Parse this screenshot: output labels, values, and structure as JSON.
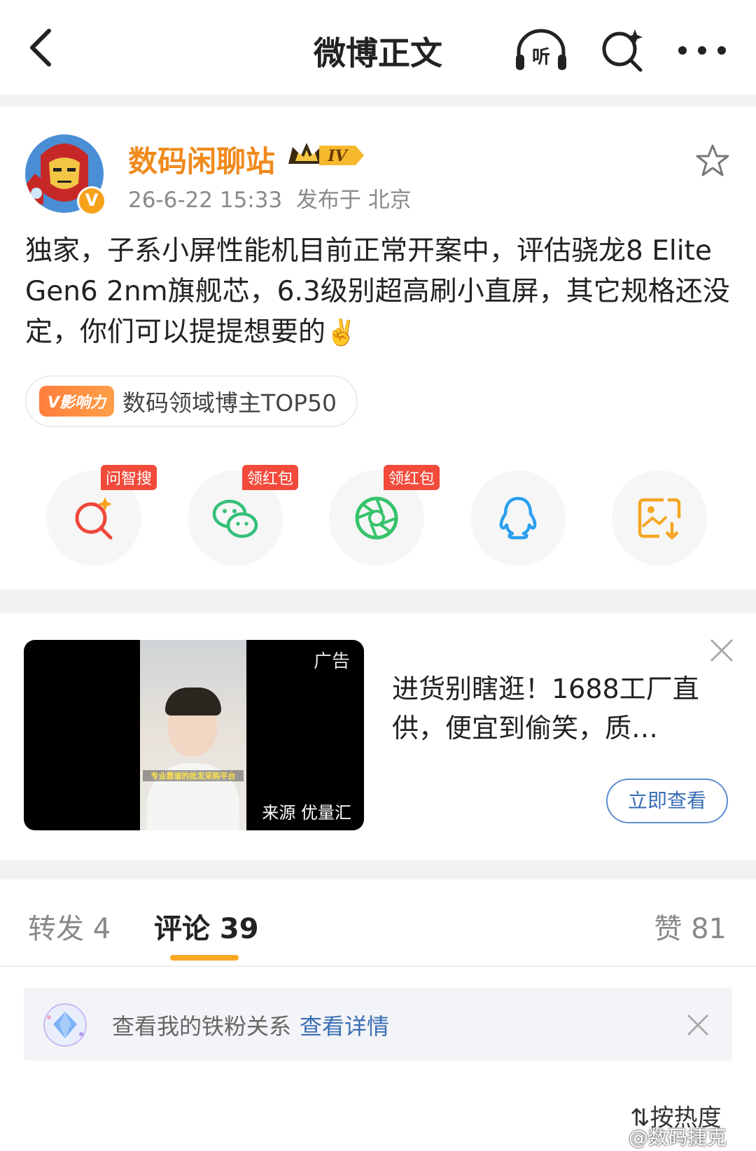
{
  "header": {
    "title": "微博正文",
    "listen_label": "听"
  },
  "post": {
    "author": "数码闲聊站",
    "level_badge": "IV",
    "verified_mark": "V",
    "timestamp": "26-6-22 15:33",
    "location": "发布于 北京",
    "content": "独家，子系小屏性能机目前正常开案中，评估骁龙8 Elite Gen6 2nm旗舰芯，6.3级别超高刷小直屏，其它规格还没定，你们可以提提想要的",
    "content_emoji": "✌️",
    "influence_tag": "V影响力",
    "influence_text": "数码领域博主TOP50"
  },
  "share": [
    {
      "icon": "ai-search-icon",
      "badge": "问智搜",
      "color": "#f0473b"
    },
    {
      "icon": "wechat-icon",
      "badge": "领红包",
      "color": "#33c07a"
    },
    {
      "icon": "moments-icon",
      "badge": "领红包",
      "color": "#36c36a"
    },
    {
      "icon": "qq-icon",
      "badge": "",
      "color": "#2b9ff0"
    },
    {
      "icon": "save-image-icon",
      "badge": "",
      "color": "#f5a623"
    }
  ],
  "ad": {
    "label": "广告",
    "source": "来源 优量汇",
    "video_caption": "专业靠谱的批发采购平台",
    "title": "进货别瞎逛！1688工厂直供，便宜到偷笑，质…",
    "button": "立即查看"
  },
  "tabs": {
    "repost": "转发 4",
    "comment": "评论 39",
    "like": "赞 81"
  },
  "fan": {
    "text": "查看我的铁粉关系",
    "link": "查看详情"
  },
  "sort_label": "按热度",
  "watermark": "@数码捷克",
  "colors": {
    "accent_orange": "#f08a1c",
    "link_blue": "#3a6eb5",
    "tab_underline": "#f9a825"
  }
}
